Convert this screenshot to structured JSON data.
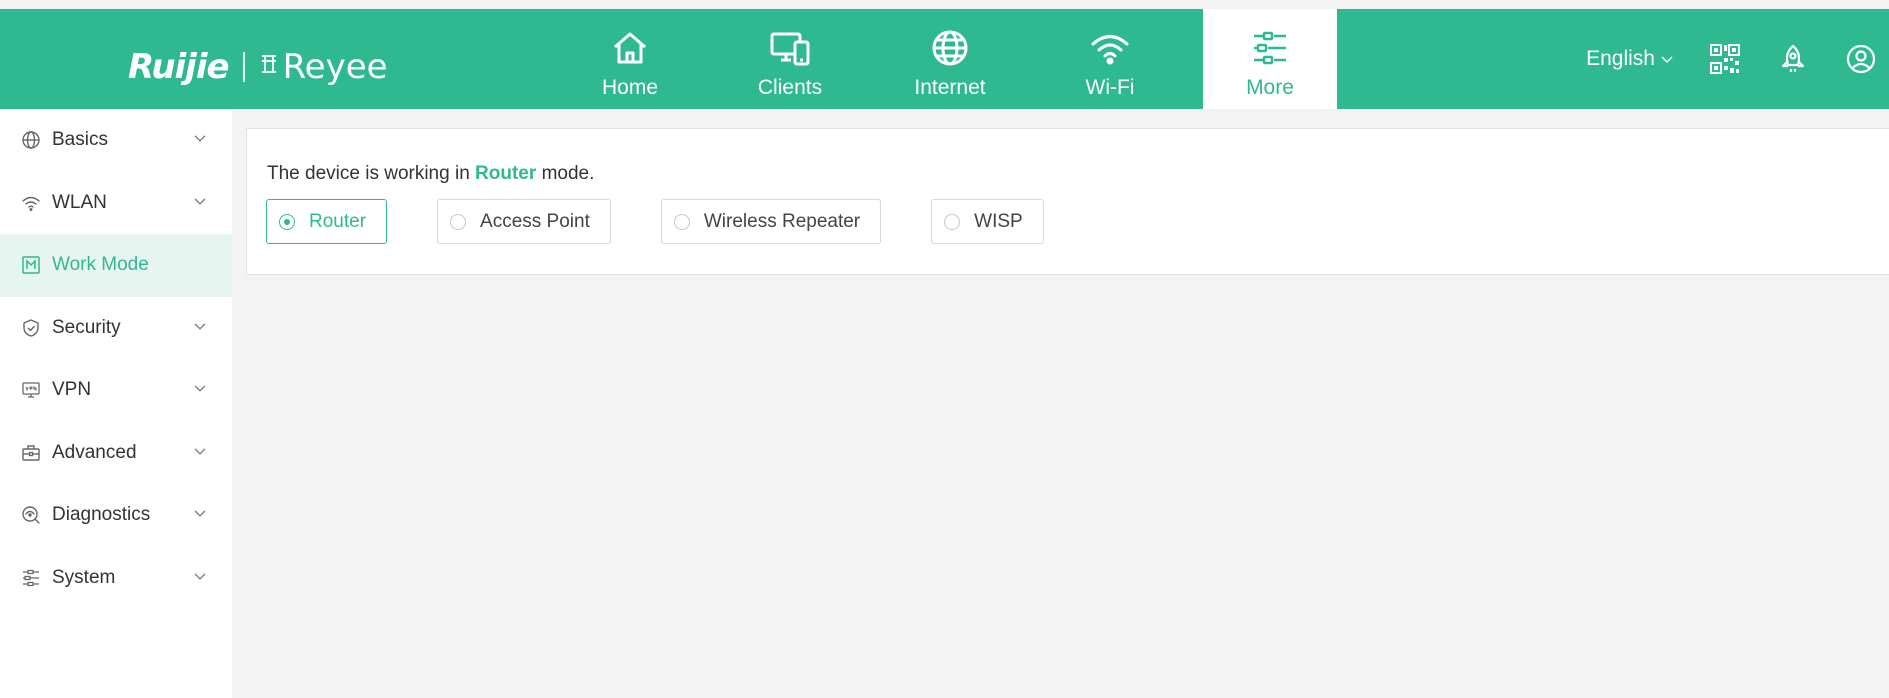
{
  "header": {
    "logo_primary": "Ruijie",
    "logo_secondary": "Reyee",
    "nav": [
      {
        "label": "Home",
        "icon": "home-icon"
      },
      {
        "label": "Clients",
        "icon": "devices-icon"
      },
      {
        "label": "Internet",
        "icon": "globe-icon"
      },
      {
        "label": "Wi-Fi",
        "icon": "wifi-icon"
      },
      {
        "label": "More",
        "icon": "sliders-icon",
        "active": true
      }
    ],
    "language": "English",
    "icons": [
      "qr-code-icon",
      "rocket-icon",
      "user-icon"
    ]
  },
  "sidebar": {
    "items": [
      {
        "label": "Basics",
        "icon": "globe-icon",
        "expandable": true
      },
      {
        "label": "WLAN",
        "icon": "wifi-icon",
        "expandable": true
      },
      {
        "label": "Work Mode",
        "icon": "work-mode-icon",
        "active": true
      },
      {
        "label": "Security",
        "icon": "shield-icon",
        "expandable": true
      },
      {
        "label": "VPN",
        "icon": "vpn-icon",
        "expandable": true
      },
      {
        "label": "Advanced",
        "icon": "toolbox-icon",
        "expandable": true
      },
      {
        "label": "Diagnostics",
        "icon": "diagnostics-icon",
        "expandable": true
      },
      {
        "label": "System",
        "icon": "settings-list-icon",
        "expandable": true
      }
    ]
  },
  "main": {
    "status_prefix": "The device is working in",
    "status_mode": "Router",
    "status_suffix": "mode.",
    "work_modes": [
      {
        "label": "Router",
        "selected": true
      },
      {
        "label": "Access Point",
        "selected": false
      },
      {
        "label": "Wireless Repeater",
        "selected": false
      },
      {
        "label": "WISP",
        "selected": false
      }
    ]
  },
  "colors": {
    "brand": "#2fb991",
    "sidebar_active_bg": "#e6f5f0",
    "page_bg": "#f3f3f3"
  }
}
